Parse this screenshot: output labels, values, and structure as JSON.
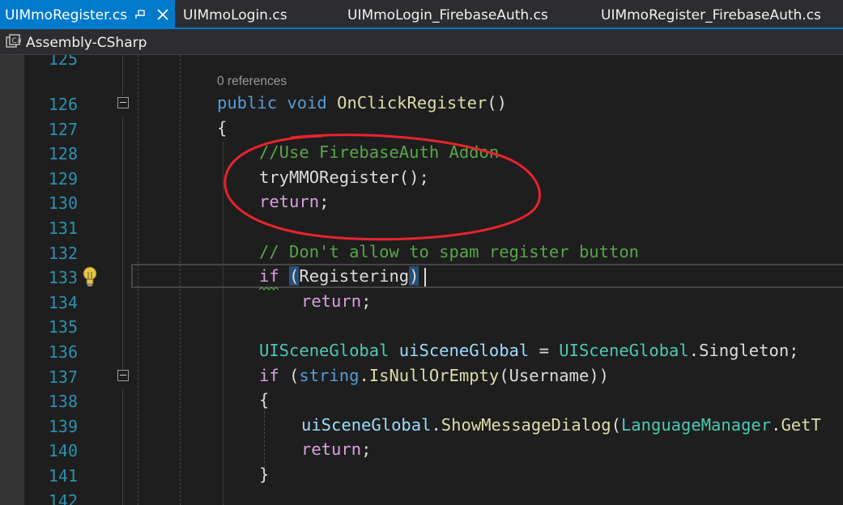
{
  "tabs": [
    {
      "label": "UIMmoRegister.cs",
      "active": true
    },
    {
      "label": "UIMmoLogin.cs",
      "active": false
    },
    {
      "label": "UIMmoLogin_FirebaseAuth.cs",
      "active": false
    },
    {
      "label": "UIMmoRegister_FirebaseAuth.cs",
      "active": false
    }
  ],
  "nav": {
    "project": "Assembly-CSharp",
    "project_icon": "csharp-project-icon"
  },
  "codelens": {
    "references": "0 references"
  },
  "lines": [
    {
      "num": "125"
    },
    {
      "num": "126",
      "code": [
        "public",
        " ",
        "void",
        " ",
        "OnClickRegister",
        "()"
      ]
    },
    {
      "num": "127",
      "code": [
        "{"
      ]
    },
    {
      "num": "128",
      "code": [
        "//Use FirebaseAuth Addon"
      ]
    },
    {
      "num": "129",
      "code": [
        "tryMMORegister",
        "();"
      ]
    },
    {
      "num": "130",
      "code": [
        "return",
        ";"
      ]
    },
    {
      "num": "131"
    },
    {
      "num": "132",
      "code": [
        "// Don't allow to spam register button"
      ]
    },
    {
      "num": "133",
      "code": [
        "if",
        " ",
        "(",
        "Registering",
        ")"
      ]
    },
    {
      "num": "134",
      "code": [
        "return",
        ";"
      ]
    },
    {
      "num": "135"
    },
    {
      "num": "136",
      "code": [
        "UISceneGlobal",
        " ",
        "uiSceneGlobal",
        " = ",
        "UISceneGlobal",
        ".",
        "Singleton",
        ";"
      ]
    },
    {
      "num": "137",
      "code": [
        "if",
        " (",
        "string",
        ".",
        "IsNullOrEmpty",
        "(",
        "Username",
        "))"
      ]
    },
    {
      "num": "138",
      "code": [
        "{"
      ]
    },
    {
      "num": "139",
      "code": [
        "uiSceneGlobal",
        ".",
        "ShowMessageDialog",
        "(",
        "LanguageManager",
        ".",
        "GetT"
      ]
    },
    {
      "num": "140",
      "code": [
        "return",
        ";"
      ]
    },
    {
      "num": "141",
      "code": [
        "}"
      ]
    },
    {
      "num": "142"
    }
  ],
  "colors": {
    "accent": "#007acc",
    "line_number": "#2b91af",
    "keyword": "#569cd6",
    "control_keyword": "#d8a0df",
    "type": "#4ec9b0",
    "method": "#dcdcaa",
    "comment": "#57a64a",
    "variable": "#9cdcfe",
    "annotation": "#e8232e"
  },
  "icons": [
    "pin-icon",
    "close-icon",
    "csharp-project-icon",
    "collapse-icon",
    "lightbulb-icon"
  ]
}
